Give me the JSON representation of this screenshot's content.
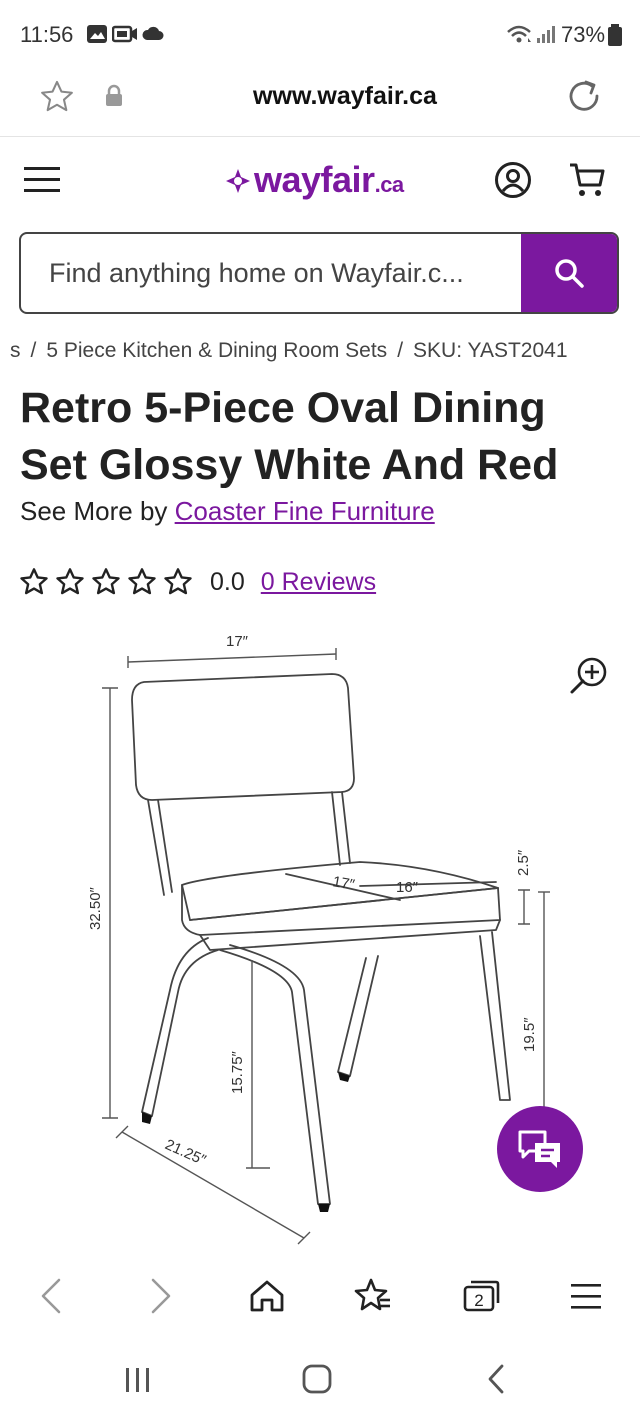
{
  "status_bar": {
    "time": "11:56",
    "battery": "73%"
  },
  "browser": {
    "url": "www.wayfair.ca",
    "tab_count": "2"
  },
  "header": {
    "logo_main": "wayfair",
    "logo_tld": ".ca"
  },
  "search": {
    "placeholder": "Find anything home on Wayfair.c..."
  },
  "breadcrumb": {
    "prev": "s",
    "category": "5 Piece Kitchen & Dining Room Sets",
    "sku": "SKU: YAST2041"
  },
  "product": {
    "title": "Retro 5-Piece Oval Dining Set Glossy White And Red",
    "see_more_prefix": "See More by ",
    "brand": "Coaster Fine Furniture",
    "rating": 0.0,
    "rating_text": "0.0",
    "reviews": "0 Reviews"
  },
  "dimensions": {
    "top_width": "17″",
    "height": "32.50″",
    "seat_width": "17″",
    "seat_depth": "16″",
    "seat_thickness": "2.5″",
    "seat_height": "19.5″",
    "leg_height": "15.75″",
    "base_depth": "21.25″"
  },
  "colors": {
    "brand_purple": "#7b189f"
  },
  "icons": [
    "star-outline-icon",
    "lock-icon",
    "reload-icon",
    "menu-icon",
    "account-icon",
    "cart-icon",
    "search-icon",
    "zoom-in-icon",
    "chat-icon",
    "back-icon",
    "forward-icon",
    "home-icon",
    "bookmarks-icon",
    "tabs-icon",
    "browser-menu-icon"
  ]
}
